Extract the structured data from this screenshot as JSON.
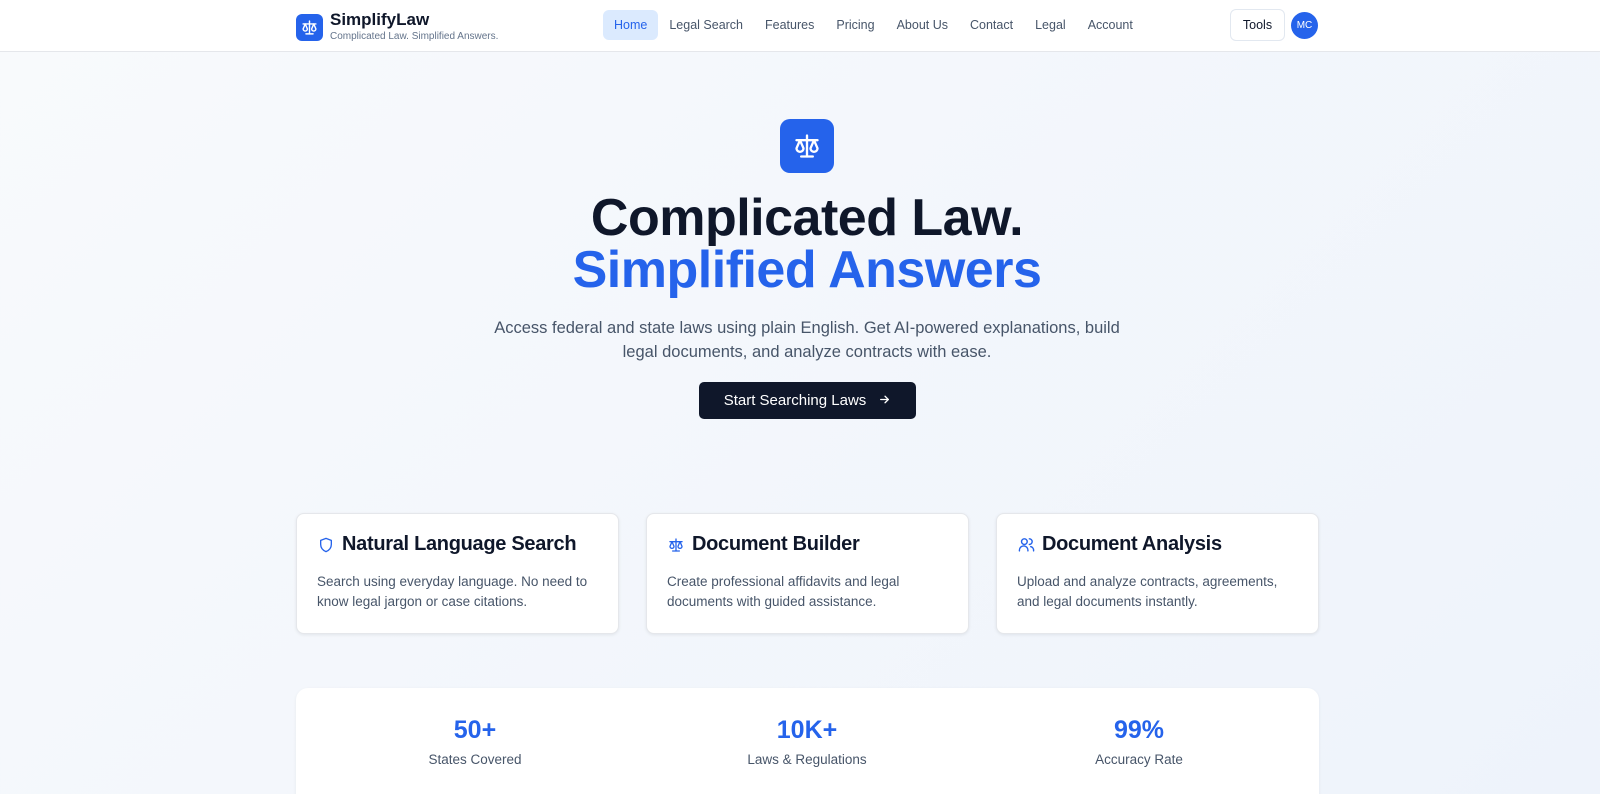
{
  "brand": {
    "name": "SimplifyLaw",
    "tagline": "Complicated Law. Simplified Answers.",
    "logo_icon": "scales-icon",
    "color": "#2563eb"
  },
  "nav": {
    "items": [
      {
        "label": "Home",
        "active": true
      },
      {
        "label": "Legal Search",
        "active": false
      },
      {
        "label": "Features",
        "active": false
      },
      {
        "label": "Pricing",
        "active": false
      },
      {
        "label": "About Us",
        "active": false
      },
      {
        "label": "Contact",
        "active": false
      },
      {
        "label": "Legal",
        "active": false
      },
      {
        "label": "Account",
        "active": false
      }
    ],
    "tools_label": "Tools",
    "avatar_initials": "MC"
  },
  "hero": {
    "icon": "scales-icon",
    "title_line1": "Complicated Law.",
    "title_line2": "Simplified Answers",
    "subtitle": "Access federal and state laws using plain English. Get AI-powered explanations, build legal documents, and analyze contracts with ease.",
    "cta_label": "Start Searching Laws",
    "cta_icon": "arrow-right-icon"
  },
  "features": [
    {
      "icon": "shield-icon",
      "title": "Natural Language Search",
      "description": "Search using everyday language. No need to know legal jargon or case citations."
    },
    {
      "icon": "scales-icon",
      "title": "Document Builder",
      "description": "Create professional affidavits and legal documents with guided assistance."
    },
    {
      "icon": "users-icon",
      "title": "Document Analysis",
      "description": "Upload and analyze contracts, agreements, and legal documents instantly."
    }
  ],
  "stats": [
    {
      "value": "50+",
      "label": "States Covered"
    },
    {
      "value": "10K+",
      "label": "Laws & Regulations"
    },
    {
      "value": "99%",
      "label": "Accuracy Rate"
    }
  ],
  "colors": {
    "accent": "#2563eb",
    "dark": "#0f172a",
    "muted": "#475569"
  }
}
